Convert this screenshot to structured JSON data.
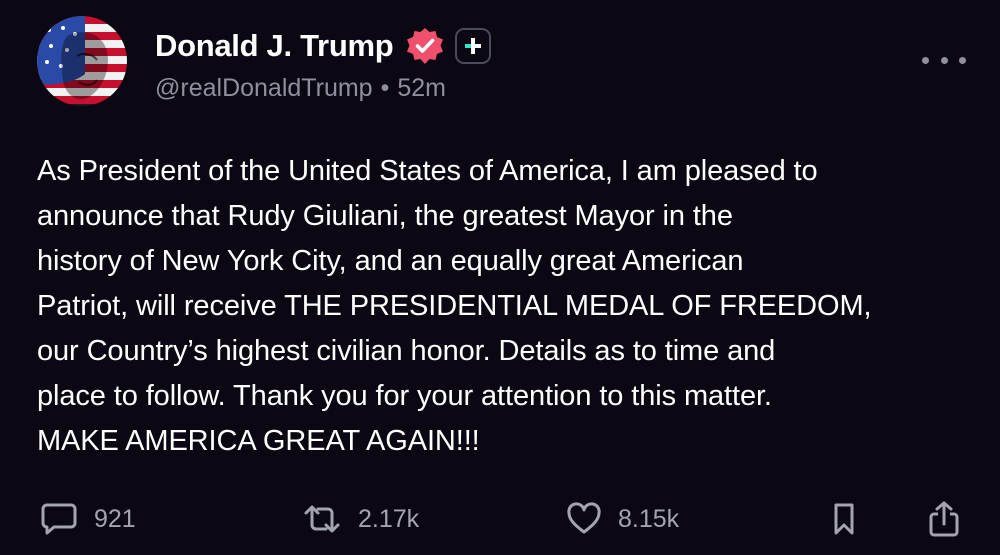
{
  "author": {
    "display_name": "Donald J. Trump",
    "handle": "@realDonaldTrump",
    "separator": "•",
    "time_ago": "52m",
    "avatar_icon": "flag-portrait-avatar",
    "verified_icon": "verified-badge-icon",
    "verified_color": "#f0506e",
    "plus_icon": "plus-badge-icon"
  },
  "post": {
    "text": "As President of the United States of America, I am pleased to\nannounce that Rudy Giuliani, the greatest Mayor in the\nhistory of New York City, and an equally great American\nPatriot, will receive THE PRESIDENTIAL MEDAL OF FREEDOM,\nour Country’s highest civilian honor. Details as to time and\nplace to follow. Thank you for your attention to this matter.\nMAKE AMERICA GREAT AGAIN!!!"
  },
  "actions": {
    "replies": "921",
    "reposts": "2.17k",
    "likes": "8.15k"
  },
  "colors": {
    "background": "#0b0814",
    "text": "#ffffff",
    "muted": "#8f8f9f",
    "accent_teal": "#2ee6c8"
  }
}
